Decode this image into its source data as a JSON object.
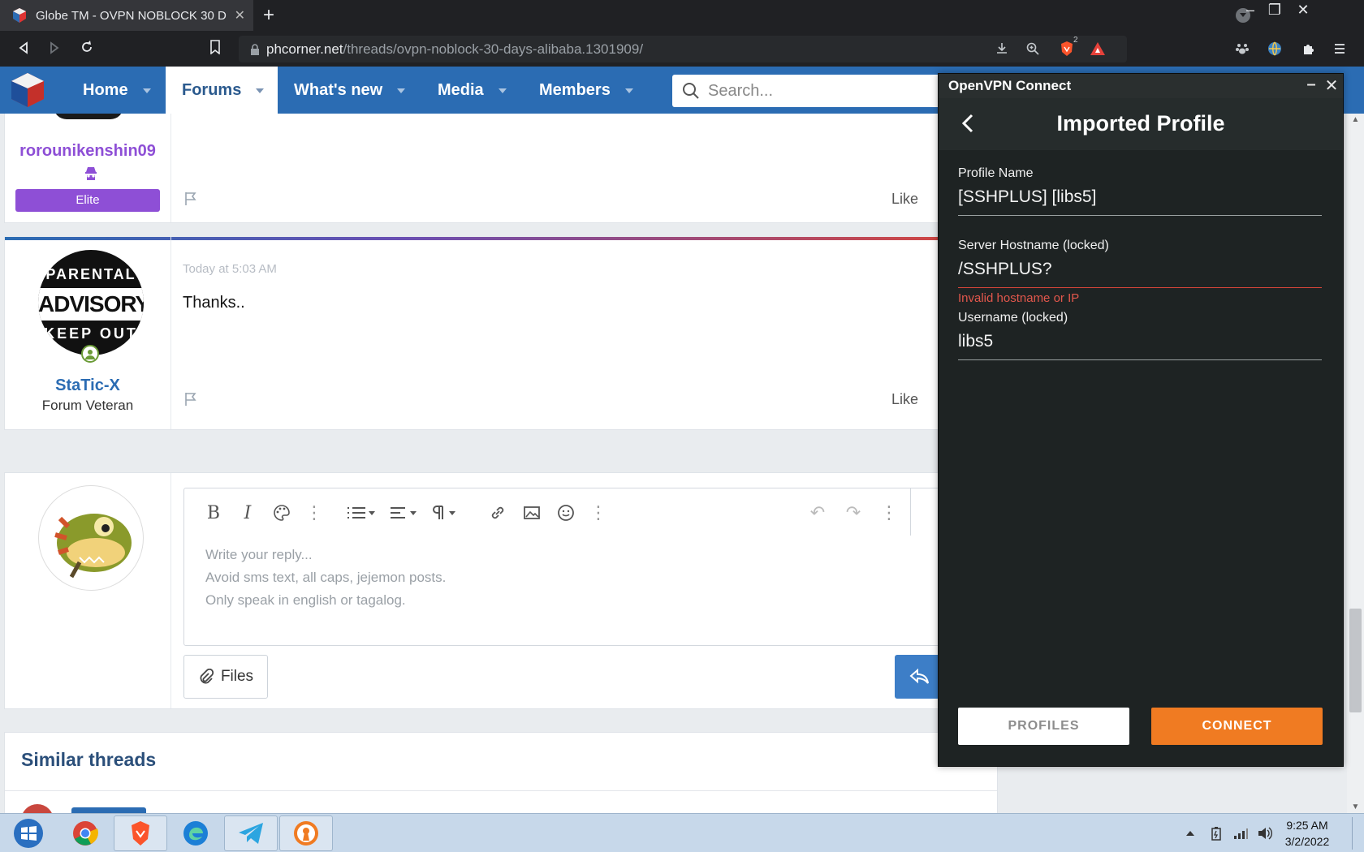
{
  "browser": {
    "tab_title": "Globe TM - OVPN NOBLOCK 30 D",
    "url_domain": "phcorner.net",
    "url_path": "/threads/ovpn-noblock-30-days-alibaba.1301909/",
    "shield_count": "2"
  },
  "site_nav": {
    "items": [
      {
        "label": "Home"
      },
      {
        "label": "Forums",
        "active": true
      },
      {
        "label": "What's new"
      },
      {
        "label": "Media"
      },
      {
        "label": "Members"
      }
    ],
    "search_placeholder": "Search..."
  },
  "posts": [
    {
      "username": "rorounikenshin09",
      "badge": "Elite",
      "like_label": "Like"
    },
    {
      "avatar_text": [
        "PARENTAL",
        "ADVISORY",
        "KEEP OUT"
      ],
      "date": "Today at 5:03 AM",
      "body": "Thanks..",
      "username": "StaTic-X",
      "user_title": "Forum Veteran",
      "like_label": "Like"
    }
  ],
  "reply": {
    "placeholder_lines": [
      "Write your reply...",
      "Avoid sms text, all caps, jejemon posts.",
      "Only speak in english or tagalog."
    ],
    "files_label": "Files"
  },
  "similar_threads": {
    "title": "Similar threads"
  },
  "ovpn": {
    "window_title": "OpenVPN Connect",
    "heading": "Imported Profile",
    "fields": [
      {
        "label": "Profile Name",
        "value": "[SSHPLUS] [libs5]"
      },
      {
        "label": "Server Hostname (locked)",
        "value": "/SSHPLUS?",
        "error": "Invalid hostname or IP"
      },
      {
        "label": "Username (locked)",
        "value": "libs5"
      }
    ],
    "profiles_button": "PROFILES",
    "connect_button": "CONNECT",
    "accent": "#f07b22"
  },
  "taskbar": {
    "apps": [
      "windows-start",
      "chrome",
      "brave",
      "edge",
      "telegram",
      "openvpn"
    ],
    "time": "9:25 AM",
    "date": "3/2/2022"
  },
  "colors": {
    "nav_blue": "#2b6cb3",
    "elite_purple": "#8e4fd6",
    "username_purple": "#8e4fd6",
    "username_blue": "#2b6cb3"
  }
}
